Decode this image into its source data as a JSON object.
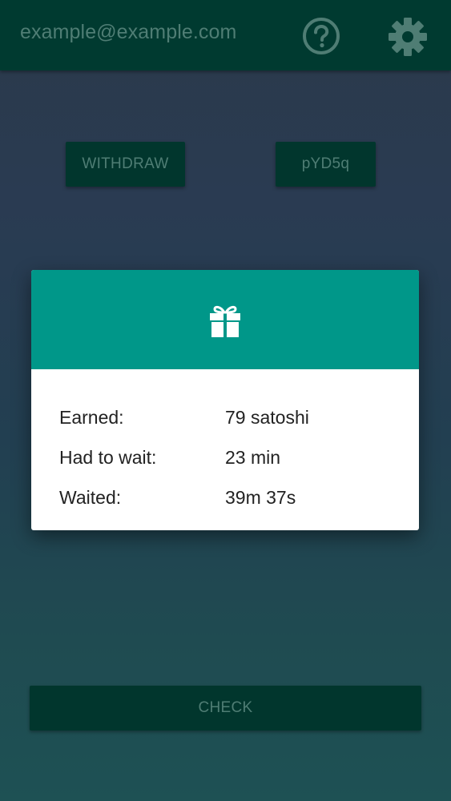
{
  "appbar": {
    "email": "example@example.com",
    "help_icon": "help-circle-icon",
    "settings_icon": "gear-icon",
    "bar_color": "#003a30",
    "text_color": "#4f7d74"
  },
  "buttons": {
    "withdraw": "WITHDRAW",
    "code": "pYD5q",
    "check": "CHECK"
  },
  "dialog": {
    "icon": "gift-icon",
    "header_color": "#009789",
    "rows": [
      {
        "label": "Earned:",
        "value": "79 satoshi"
      },
      {
        "label": "Had to wait:",
        "value": "23 min"
      },
      {
        "label": "Waited:",
        "value": "39m 37s"
      }
    ]
  }
}
